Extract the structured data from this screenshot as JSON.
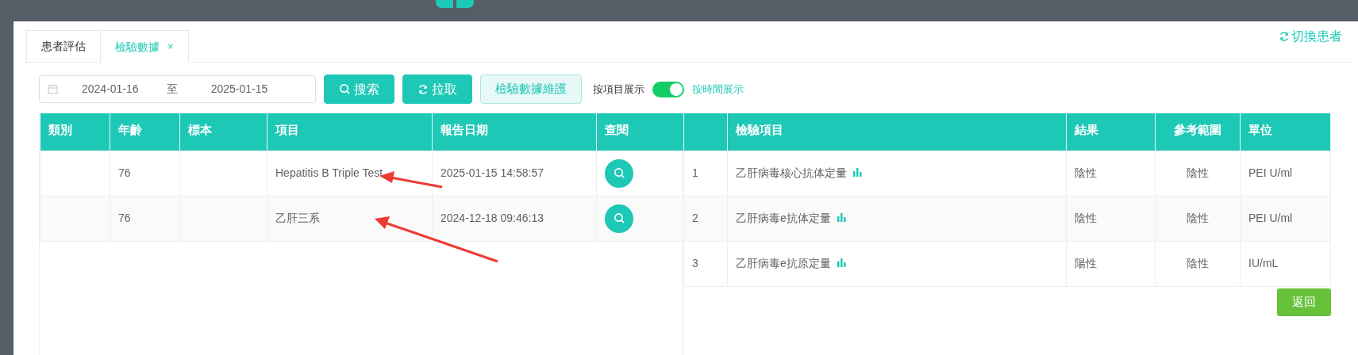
{
  "switch_patient": "切換患者",
  "tabs": [
    {
      "label": "患者評估",
      "selected": false
    },
    {
      "label": "檢驗數據",
      "selected": true,
      "close_label": "×"
    }
  ],
  "filters": {
    "date_start": "2024-01-16",
    "separator": "至",
    "date_end": "2025-01-15"
  },
  "buttons": [
    {
      "kind": "search",
      "label": "搜索"
    },
    {
      "kind": "pull",
      "label": "拉取"
    },
    {
      "kind": "maintain",
      "label": "檢驗數據維護"
    }
  ],
  "view_switch": {
    "left_label": "按項目展示",
    "right_label": "按時間展示",
    "on": true
  },
  "reports": {
    "columns": [
      "類別",
      "年齡",
      "標本",
      "項目",
      "報告日期",
      "查閱"
    ],
    "rows": [
      {
        "age": "76",
        "item": "Hepatitis B Triple Test",
        "report_date": "2025-01-15 14:58:57"
      },
      {
        "age": "76",
        "item": "乙肝三系",
        "report_date": "2024-12-18 09:46:13"
      }
    ]
  },
  "results": {
    "columns": [
      "檢驗項目",
      "結果",
      "參考範圍",
      "單位"
    ],
    "rows": [
      {
        "no": "1",
        "test": "乙肝病毒核心抗体定量",
        "result": "陰性",
        "reference": "陰性",
        "unit": "PEI U/ml"
      },
      {
        "no": "2",
        "test": "乙肝病毒e抗体定量",
        "result": "陰性",
        "reference": "陰性",
        "unit": "PEI U/ml"
      },
      {
        "no": "3",
        "test": "乙肝病毒e抗原定量",
        "result": "陽性",
        "reference": "陰性",
        "unit": "IU/mL"
      }
    ]
  },
  "back_button": "返回"
}
